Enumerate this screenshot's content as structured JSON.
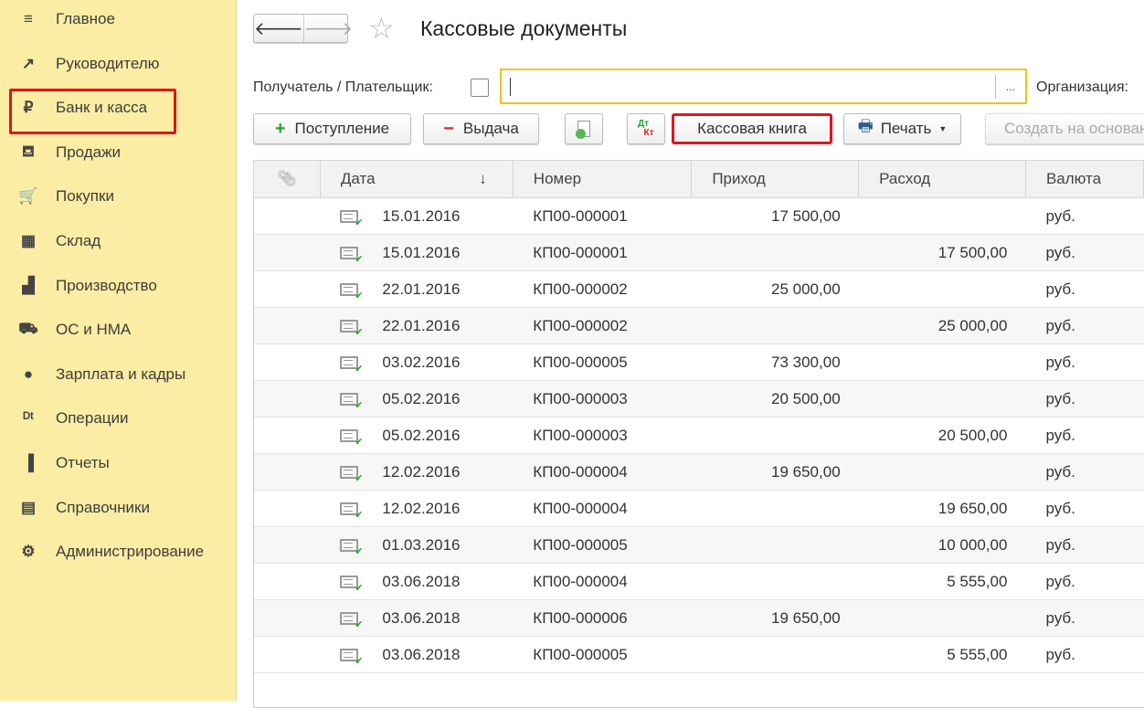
{
  "sidebar": {
    "items": [
      {
        "label": "Главное",
        "icon": "menu-icon",
        "glyph": "≡"
      },
      {
        "label": "Руководителю",
        "icon": "trend-icon",
        "glyph": "↗"
      },
      {
        "label": "Банк и касса",
        "icon": "ruble-icon",
        "glyph": "₽",
        "active": true
      },
      {
        "label": "Продажи",
        "icon": "bag-icon",
        "glyph": "⛾"
      },
      {
        "label": "Покупки",
        "icon": "cart-icon",
        "glyph": "🛒"
      },
      {
        "label": "Склад",
        "icon": "warehouse-icon",
        "glyph": "▦"
      },
      {
        "label": "Производство",
        "icon": "factory-icon",
        "glyph": "▟"
      },
      {
        "label": "ОС и НМА",
        "icon": "truck-icon",
        "glyph": "⛟"
      },
      {
        "label": "Зарплата и кадры",
        "icon": "person-icon",
        "glyph": "●"
      },
      {
        "label": "Операции",
        "icon": "dt-kt-icon",
        "glyph": "ᴰᵗ"
      },
      {
        "label": "Отчеты",
        "icon": "bar-chart-icon",
        "glyph": "▐"
      },
      {
        "label": "Справочники",
        "icon": "books-icon",
        "glyph": "▤"
      },
      {
        "label": "Администрирование",
        "icon": "gear-icon",
        "glyph": "⚙"
      }
    ]
  },
  "header": {
    "title": "Кассовые документы",
    "back": "🡐",
    "forward": "🡒",
    "star": "☆"
  },
  "filter": {
    "payer_label": "Получатель / Плательщик:",
    "payer_value": "",
    "dots": "...",
    "org_label": "Организация:"
  },
  "toolbar": {
    "receipt": "Поступление",
    "issue": "Выдача",
    "cash_book": "Кассовая книга",
    "print": "Печать",
    "create_based": "Создать на основании",
    "plus": "+",
    "minus": "−",
    "dt": "Дт",
    "kt": "Кт"
  },
  "table": {
    "columns": [
      "Дата",
      "Номер",
      "Приход",
      "Расход",
      "Валюта"
    ],
    "sort_arrow": "↓",
    "rows": [
      [
        "15.01.2016",
        "КП00-000001",
        "17 500,00",
        "",
        "руб."
      ],
      [
        "15.01.2016",
        "КП00-000001",
        "",
        "17 500,00",
        "руб."
      ],
      [
        "22.01.2016",
        "КП00-000002",
        "25 000,00",
        "",
        "руб."
      ],
      [
        "22.01.2016",
        "КП00-000002",
        "",
        "25 000,00",
        "руб."
      ],
      [
        "03.02.2016",
        "КП00-000005",
        "73 300,00",
        "",
        "руб."
      ],
      [
        "05.02.2016",
        "КП00-000003",
        "20 500,00",
        "",
        "руб."
      ],
      [
        "05.02.2016",
        "КП00-000003",
        "",
        "20 500,00",
        "руб."
      ],
      [
        "12.02.2016",
        "КП00-000004",
        "19 650,00",
        "",
        "руб."
      ],
      [
        "12.02.2016",
        "КП00-000004",
        "",
        "19 650,00",
        "руб."
      ],
      [
        "01.03.2016",
        "КП00-000005",
        "",
        "10 000,00",
        "руб."
      ],
      [
        "03.06.2018",
        "КП00-000004",
        "",
        "5 555,00",
        "руб."
      ],
      [
        "03.06.2018",
        "КП00-000006",
        "19 650,00",
        "",
        "руб."
      ],
      [
        "03.06.2018",
        "КП00-000005",
        "",
        "5 555,00",
        "руб."
      ]
    ]
  }
}
